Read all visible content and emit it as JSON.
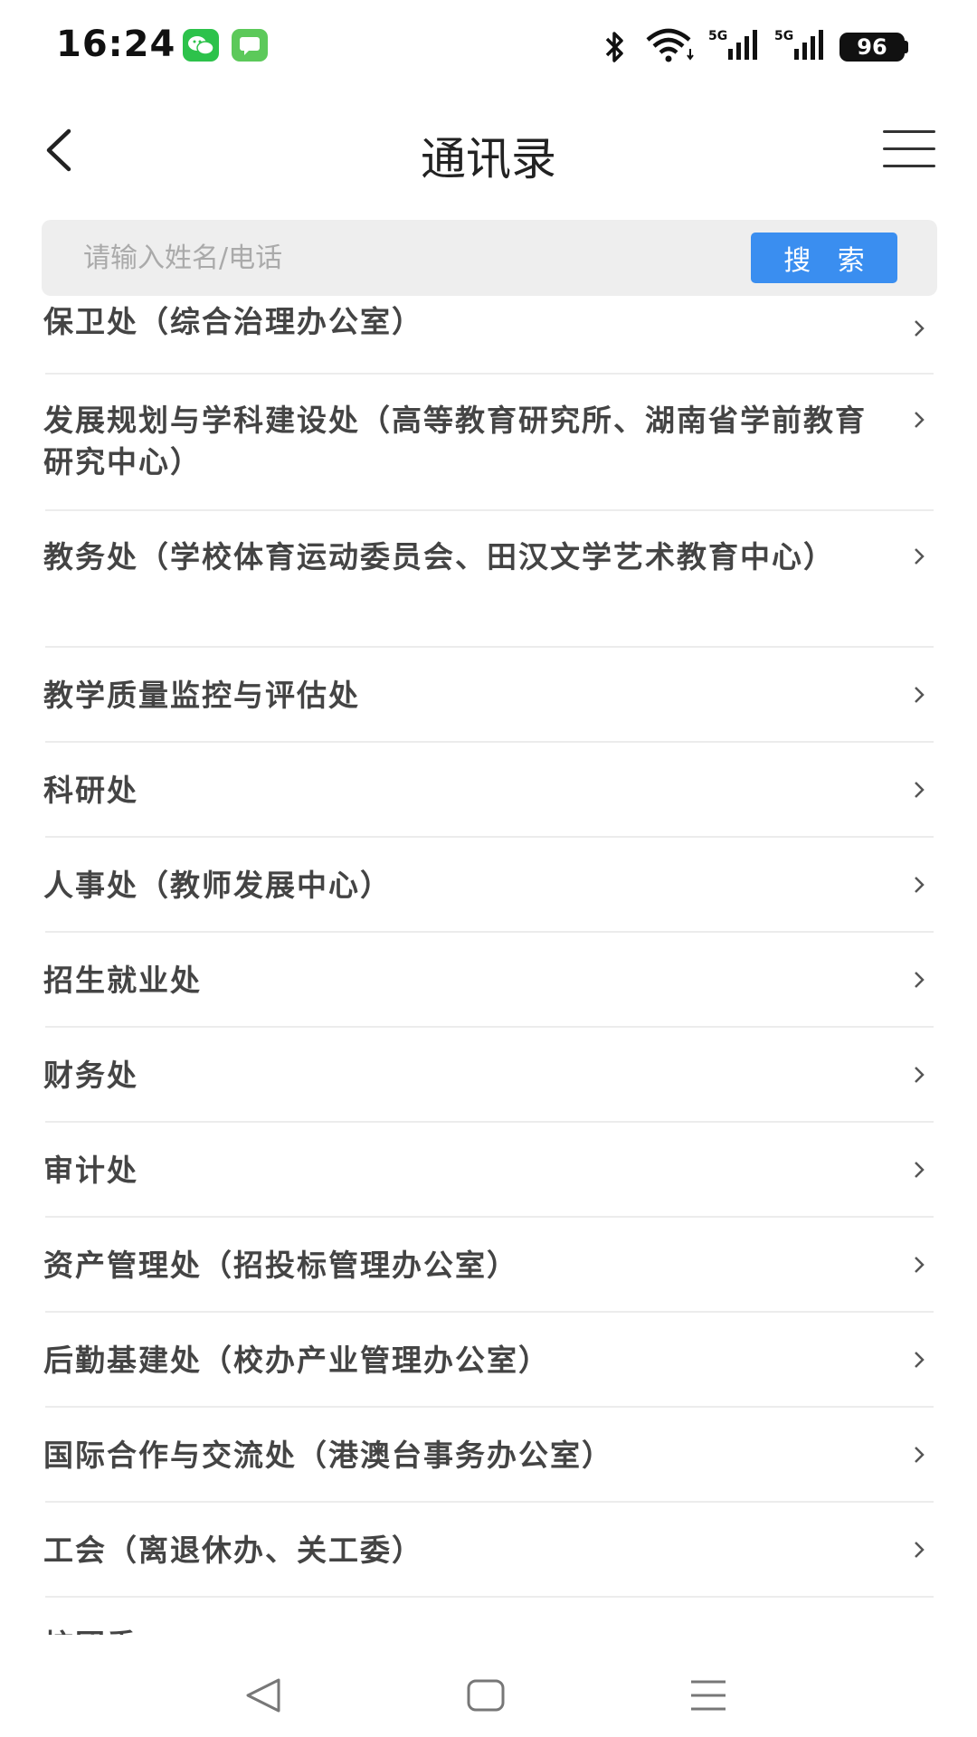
{
  "status_bar": {
    "time": "16:24",
    "battery": "96",
    "signal_labels": [
      "5G",
      "5G"
    ]
  },
  "header": {
    "title": "通讯录"
  },
  "search": {
    "placeholder": "请输入姓名/电话",
    "button_label": "搜 索"
  },
  "list": {
    "items": [
      "保卫处（综合治理办公室）",
      "发展规划与学科建设处（高等教育研究所、湖南省学前教育研究中心）",
      "教务处（学校体育运动委员会、田汉文学艺术教育中心）",
      "教学质量监控与评估处",
      "科研处",
      "人事处（教师发展中心）",
      "招生就业处",
      "财务处",
      "审计处",
      "资产管理处（招投标管理办公室）",
      "后勤基建处（校办产业管理办公室）",
      "国际合作与交流处（港澳台事务办公室）",
      "工会（离退休办、关工委）",
      "校团委"
    ]
  },
  "colors": {
    "accent": "#3a8ef0",
    "search_bg": "#eeeeee",
    "text": "#444444"
  }
}
